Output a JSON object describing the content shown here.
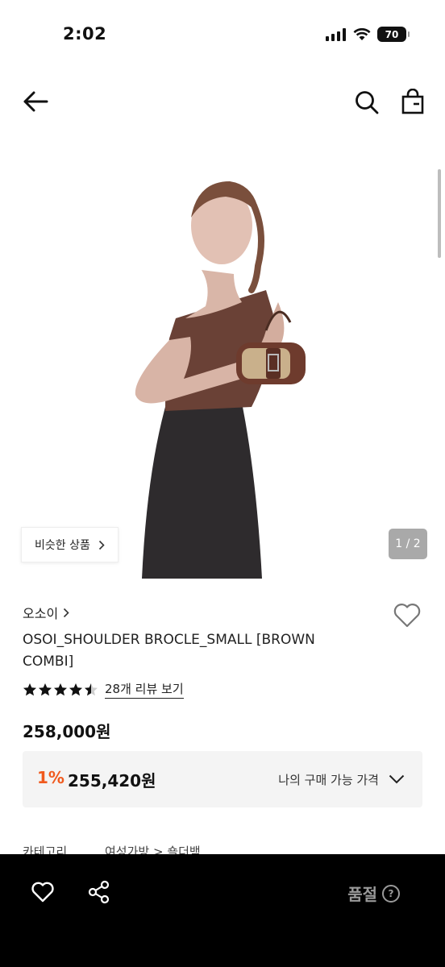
{
  "status": {
    "time": "2:02",
    "battery": "70"
  },
  "product": {
    "pager": "1 / 2",
    "similar_label": "비슷한 상품",
    "brand": "오소이",
    "title": "OSOI_SHOULDER BROCLE_SMALL [BROWN COMBI]",
    "rating": 4.5,
    "review_link": "28개 리뷰 보기",
    "price": "258,000원",
    "discount_pct": "1%",
    "discount_price": "255,420원",
    "discount_label": "나의 구매 가능 가격",
    "category_label": "카테고리",
    "category_value": "여성가방 > 숄더백"
  },
  "bottom": {
    "soldout_label": "품절",
    "help_icon": "?"
  },
  "icons": [
    "back-arrow-icon",
    "search-icon",
    "shopping-bag-icon",
    "chevron-right-icon",
    "heart-icon",
    "star-icon",
    "chevron-down-icon",
    "share-icon",
    "help-icon"
  ]
}
